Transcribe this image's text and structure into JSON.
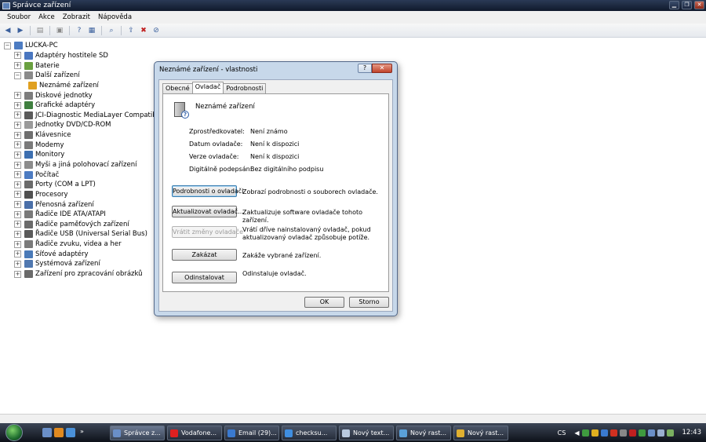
{
  "window": {
    "title": "Správce zařízení"
  },
  "menu": [
    "Soubor",
    "Akce",
    "Zobrazit",
    "Nápověda"
  ],
  "tree": {
    "root": "LUCKA-PC",
    "items": [
      {
        "label": "Adaptéry hostitele SD",
        "icon": "sd-host-icon",
        "color": "#4a77c0",
        "expanded": false,
        "child": false
      },
      {
        "label": "Baterie",
        "icon": "battery-icon",
        "color": "#6aa040",
        "expanded": false,
        "child": false
      },
      {
        "label": "Další zařízení",
        "icon": "other-devices-icon",
        "color": "#8a8a8a",
        "expanded": true,
        "child": false
      },
      {
        "label": "Neznámé zařízení",
        "icon": "unknown-device-warning-icon",
        "color": "#e0a020",
        "expanded": false,
        "child": true
      },
      {
        "label": "Diskové jednotky",
        "icon": "disk-drive-icon",
        "color": "#7d7d7d",
        "expanded": false,
        "child": false
      },
      {
        "label": "Grafické adaptéry",
        "icon": "display-adapter-icon",
        "color": "#3f7f3f",
        "expanded": false,
        "child": false
      },
      {
        "label": "JCI-Diagnostic MediaLayer Compatible Devices",
        "icon": "jci-device-icon",
        "color": "#5a5a5a",
        "expanded": false,
        "child": false
      },
      {
        "label": "Jednotky DVD/CD-ROM",
        "icon": "dvd-drive-icon",
        "color": "#9a9a9a",
        "expanded": false,
        "child": false
      },
      {
        "label": "Klávesnice",
        "icon": "keyboard-icon",
        "color": "#6f6f6f",
        "expanded": false,
        "child": false
      },
      {
        "label": "Modemy",
        "icon": "modem-icon",
        "color": "#7a7a7a",
        "expanded": false,
        "child": false
      },
      {
        "label": "Monitory",
        "icon": "monitor-icon",
        "color": "#3d6fb0",
        "expanded": false,
        "child": false
      },
      {
        "label": "Myši a jiná polohovací zařízení",
        "icon": "mouse-icon",
        "color": "#8c8c8c",
        "expanded": false,
        "child": false
      },
      {
        "label": "Počítač",
        "icon": "computer-icon",
        "color": "#4d7cc2",
        "expanded": false,
        "child": false
      },
      {
        "label": "Porty (COM a LPT)",
        "icon": "port-icon",
        "color": "#6a6a6a",
        "expanded": false,
        "child": false
      },
      {
        "label": "Procesory",
        "icon": "processor-icon",
        "color": "#505050",
        "expanded": false,
        "child": false
      },
      {
        "label": "Přenosná zařízení",
        "icon": "portable-device-icon",
        "color": "#4a6fa8",
        "expanded": false,
        "child": false
      },
      {
        "label": "Řadiče IDE ATA/ATAPI",
        "icon": "ide-controller-icon",
        "color": "#7a7a7a",
        "expanded": false,
        "child": false
      },
      {
        "label": "Řadiče paměťových zařízení",
        "icon": "storage-controller-icon",
        "color": "#6a6a6a",
        "expanded": false,
        "child": false
      },
      {
        "label": "Řadiče USB (Universal Serial Bus)",
        "icon": "usb-controller-icon",
        "color": "#5a5a5a",
        "expanded": false,
        "child": false
      },
      {
        "label": "Řadiče zvuku, videa a her",
        "icon": "sound-controller-icon",
        "color": "#7a7a7a",
        "expanded": false,
        "child": false
      },
      {
        "label": "Síťové adaptéry",
        "icon": "network-adapter-icon",
        "color": "#4a7ab8",
        "expanded": false,
        "child": false
      },
      {
        "label": "Systémová zařízení",
        "icon": "system-device-icon",
        "color": "#5078b0",
        "expanded": false,
        "child": false
      },
      {
        "label": "Zařízení pro zpracování obrázků",
        "icon": "imaging-device-icon",
        "color": "#6a6a6a",
        "expanded": false,
        "child": false
      }
    ]
  },
  "dialog": {
    "title": "Neznámé zařízení - vlastnosti",
    "help": "?",
    "close": "✕",
    "tabs": [
      "Obecné",
      "Ovladač",
      "Podrobnosti"
    ],
    "active_tab": "Ovladač",
    "device_name": "Neznámé zařízení",
    "properties": [
      {
        "label": "Zprostředkovatel:",
        "value": "Není známo"
      },
      {
        "label": "Datum ovladače:",
        "value": "Není k dispozici"
      },
      {
        "label": "Verze ovladače:",
        "value": "Není k dispozici"
      },
      {
        "label": "Digitálně podepsán:",
        "value": "Bez digitálního podpisu"
      }
    ],
    "actions": [
      {
        "label": "Podrobnosti o ovladači",
        "desc": "Zobrazí podrobnosti o souborech ovladače.",
        "enabled": true
      },
      {
        "label": "Aktualizovat ovladač...",
        "desc": "Zaktualizuje software ovladače tohoto zařízení.",
        "enabled": true
      },
      {
        "label": "Vrátit změny ovladače",
        "desc": "Vrátí dříve nainstalovaný ovladač, pokud aktualizovaný ovladač způsobuje potíže.",
        "enabled": false
      },
      {
        "label": "Zakázat",
        "desc": "Zakáže vybrané zařízení.",
        "enabled": true
      },
      {
        "label": "Odinstalovat",
        "desc": "Odinstaluje ovladač.",
        "enabled": true
      }
    ],
    "ok": "OK",
    "cancel": "Storno"
  },
  "taskbar": {
    "tasks": [
      {
        "label": "Správce z...",
        "icon": "device-manager-icon",
        "color": "#6a8fc8",
        "active": true
      },
      {
        "label": "Vodafone...",
        "icon": "vodafone-icon",
        "color": "#e02020",
        "active": false
      },
      {
        "label": "Email (29)...",
        "icon": "email-icon",
        "color": "#3a7ad0",
        "active": false
      },
      {
        "label": "checksu...",
        "icon": "ie-icon",
        "color": "#3f8ee0",
        "active": false
      },
      {
        "label": "Nový text...",
        "icon": "notepad-icon",
        "color": "#b8c9e0",
        "active": false
      },
      {
        "label": "Nový rast...",
        "icon": "paint-icon",
        "color": "#5aa0d8",
        "active": false
      },
      {
        "label": "Nový rast...",
        "icon": "paint-icon",
        "color": "#e0b030",
        "active": false
      }
    ],
    "lang": "CS",
    "clock": "12:43"
  }
}
